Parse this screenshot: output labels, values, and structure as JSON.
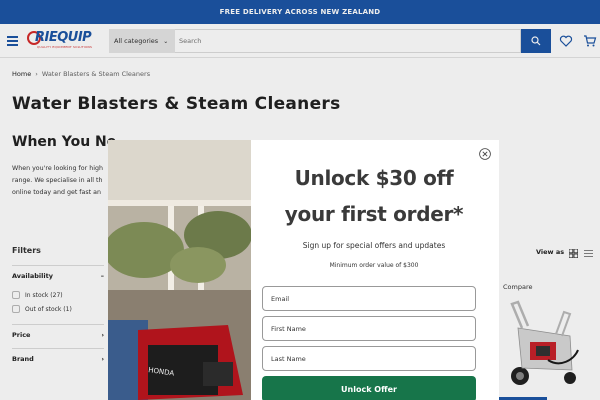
{
  "announcement": "FREE DELIVERY ACROSS NEW ZEALAND",
  "header": {
    "logo_text": "RIEQUIP",
    "logo_tagline": "QUALITY EQUIPMENT SOLUTIONS",
    "category_select": "All categories",
    "search_placeholder": "Search"
  },
  "breadcrumb": {
    "home": "Home",
    "separator": "›",
    "current": "Water Blasters & Steam Cleaners"
  },
  "page_title": "Water Blasters & Steam Cleaners",
  "subheading_visible": "When You Ne",
  "intro_lines": [
    "When you're looking for high",
    "range. We specialise in all th",
    "online today and get fast an"
  ],
  "filters": {
    "label": "Filters",
    "groups": [
      {
        "name": "Availability",
        "toggle": "–",
        "options": [
          "In stock (27)",
          "Out of stock (1)"
        ]
      },
      {
        "name": "Price",
        "toggle": "›"
      },
      {
        "name": "Brand",
        "toggle": "›"
      }
    ]
  },
  "view_as": "View as",
  "compare_label": "Compare",
  "popup": {
    "headline_line1": "Unlock $30 off",
    "headline_line2": "your first order*",
    "subtitle": "Sign up for special offers and updates",
    "minimum": "Minimum order value of $300",
    "fields": [
      {
        "placeholder": "Email"
      },
      {
        "placeholder": "First Name"
      },
      {
        "placeholder": "Last Name"
      }
    ],
    "button": "Unlock Offer",
    "image_brand": "HONDA"
  },
  "colors": {
    "brand_blue": "#1c55a6",
    "cta_green": "#17754a",
    "logo_red": "#d62a2a"
  }
}
